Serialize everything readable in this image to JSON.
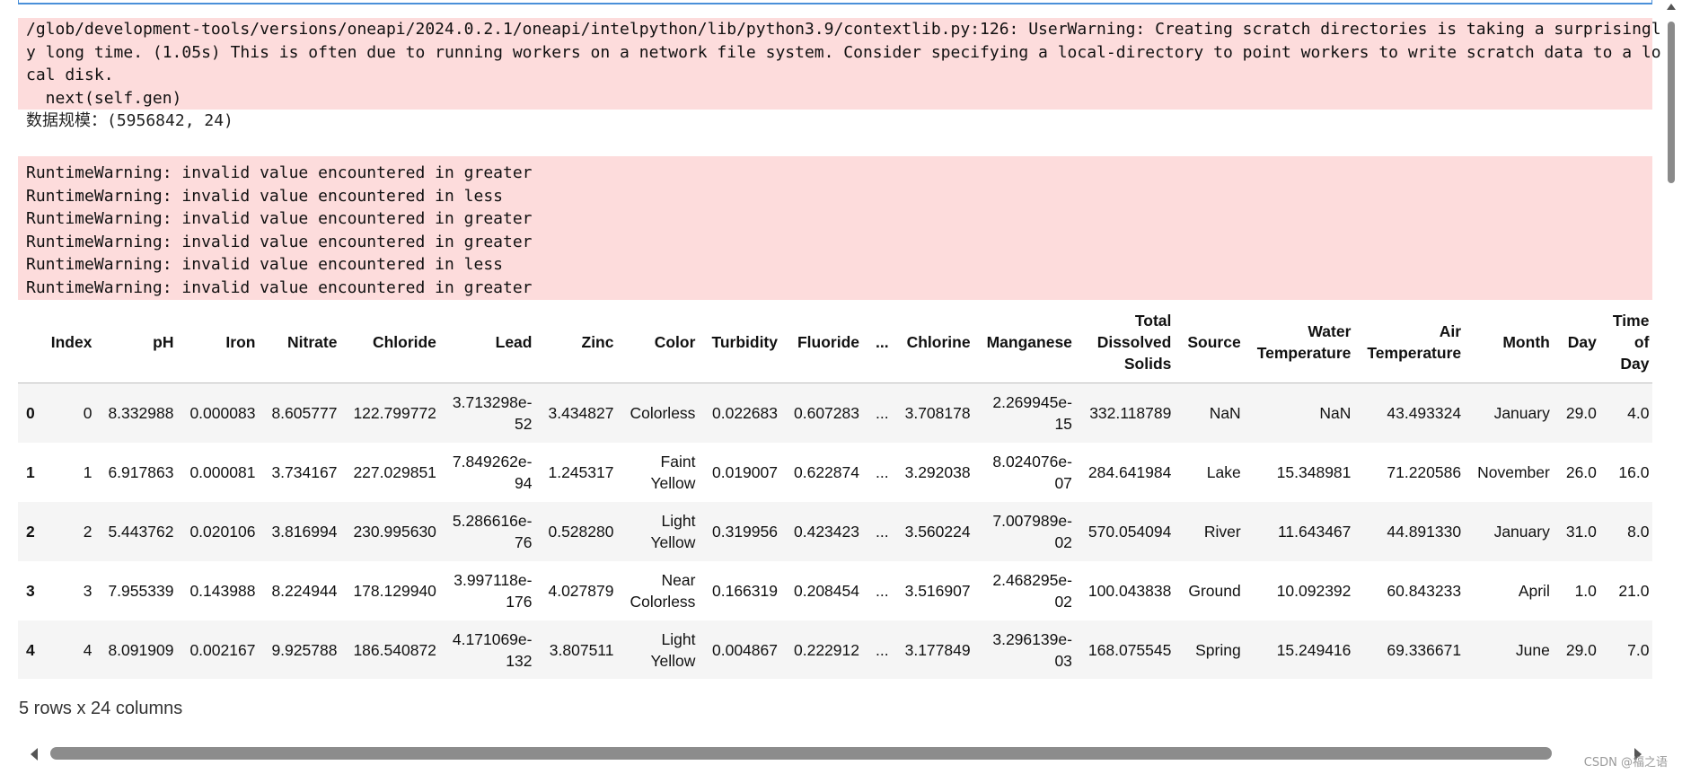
{
  "stderr1": {
    "lines": [
      "/glob/development-tools/versions/oneapi/2024.0.2.1/oneapi/intelpython/lib/python3.9/contextlib.py:126: UserWarning: Creating scratch directories is taking a surprisingl",
      "y long time. (1.05s) This is often due to running workers on a network file system. Consider specifying a local-directory to point workers to write scratch data to a lo",
      "cal disk.",
      "  next(self.gen)"
    ]
  },
  "stdout": {
    "text": "数据规模：(5956842, 24)"
  },
  "stderr2": {
    "lines": [
      "RuntimeWarning: invalid value encountered in greater",
      "RuntimeWarning: invalid value encountered in less",
      "RuntimeWarning: invalid value encountered in greater",
      "RuntimeWarning: invalid value encountered in greater",
      "RuntimeWarning: invalid value encountered in less",
      "RuntimeWarning: invalid value encountered in greater"
    ]
  },
  "table": {
    "columns": [
      "",
      "Index",
      "pH",
      "Iron",
      "Nitrate",
      "Chloride",
      "Lead",
      "Zinc",
      "Color",
      "Turbidity",
      "Fluoride",
      "...",
      "Chlorine",
      "Manganese",
      "Total Dissolved Solids",
      "Source",
      "Water Temperature",
      "Air Temperature",
      "Month",
      "Day",
      "Time of Day"
    ],
    "rows": [
      [
        "0",
        "0",
        "8.332988",
        "0.000083",
        "8.605777",
        "122.799772",
        "3.713298e-52",
        "3.434827",
        "Colorless",
        "0.022683",
        "0.607283",
        "...",
        "3.708178",
        "2.269945e-15",
        "332.118789",
        "NaN",
        "NaN",
        "43.493324",
        "January",
        "29.0",
        "4.0"
      ],
      [
        "1",
        "1",
        "6.917863",
        "0.000081",
        "3.734167",
        "227.029851",
        "7.849262e-94",
        "1.245317",
        "Faint Yellow",
        "0.019007",
        "0.622874",
        "...",
        "3.292038",
        "8.024076e-07",
        "284.641984",
        "Lake",
        "15.348981",
        "71.220586",
        "November",
        "26.0",
        "16.0"
      ],
      [
        "2",
        "2",
        "5.443762",
        "0.020106",
        "3.816994",
        "230.995630",
        "5.286616e-76",
        "0.528280",
        "Light Yellow",
        "0.319956",
        "0.423423",
        "...",
        "3.560224",
        "7.007989e-02",
        "570.054094",
        "River",
        "11.643467",
        "44.891330",
        "January",
        "31.0",
        "8.0"
      ],
      [
        "3",
        "3",
        "7.955339",
        "0.143988",
        "8.224944",
        "178.129940",
        "3.997118e-176",
        "4.027879",
        "Near Colorless",
        "0.166319",
        "0.208454",
        "...",
        "3.516907",
        "2.468295e-02",
        "100.043838",
        "Ground",
        "10.092392",
        "60.843233",
        "April",
        "1.0",
        "21.0"
      ],
      [
        "4",
        "4",
        "8.091909",
        "0.002167",
        "9.925788",
        "186.540872",
        "4.171069e-132",
        "3.807511",
        "Light Yellow",
        "0.004867",
        "0.222912",
        "...",
        "3.177849",
        "3.296139e-03",
        "168.075545",
        "Spring",
        "15.249416",
        "69.336671",
        "June",
        "29.0",
        "7.0"
      ]
    ]
  },
  "summary": "5 rows x 24 columns",
  "watermark": "CSDN @福之语"
}
